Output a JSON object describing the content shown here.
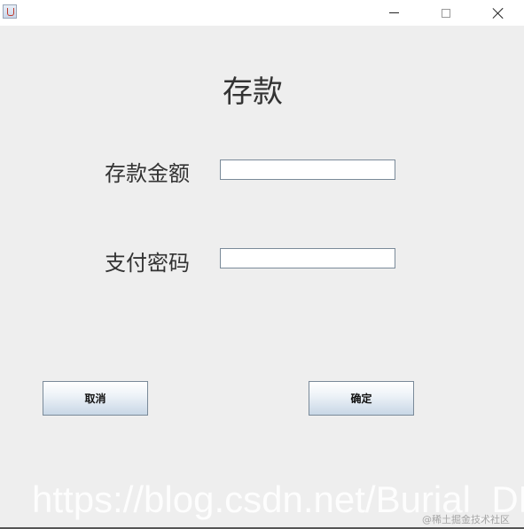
{
  "window": {
    "title": "",
    "icon": "java-app-icon",
    "controls": {
      "minimize": "minimize-icon",
      "maximize": "maximize-icon",
      "close": "close-icon"
    }
  },
  "form": {
    "heading": "存款",
    "amount_label": "存款金额",
    "amount_value": "",
    "password_label": "支付密码",
    "password_value": ""
  },
  "buttons": {
    "cancel_label": "取消",
    "confirm_label": "确定"
  },
  "watermark": {
    "url_text": "https://blog.csdn.net/Burial_DH",
    "site_text": "@稀土掘金技术社区"
  },
  "colors": {
    "background": "#eeeeee",
    "titlebar": "#ffffff",
    "button_gradient_bottom": "#c8d7e6"
  }
}
